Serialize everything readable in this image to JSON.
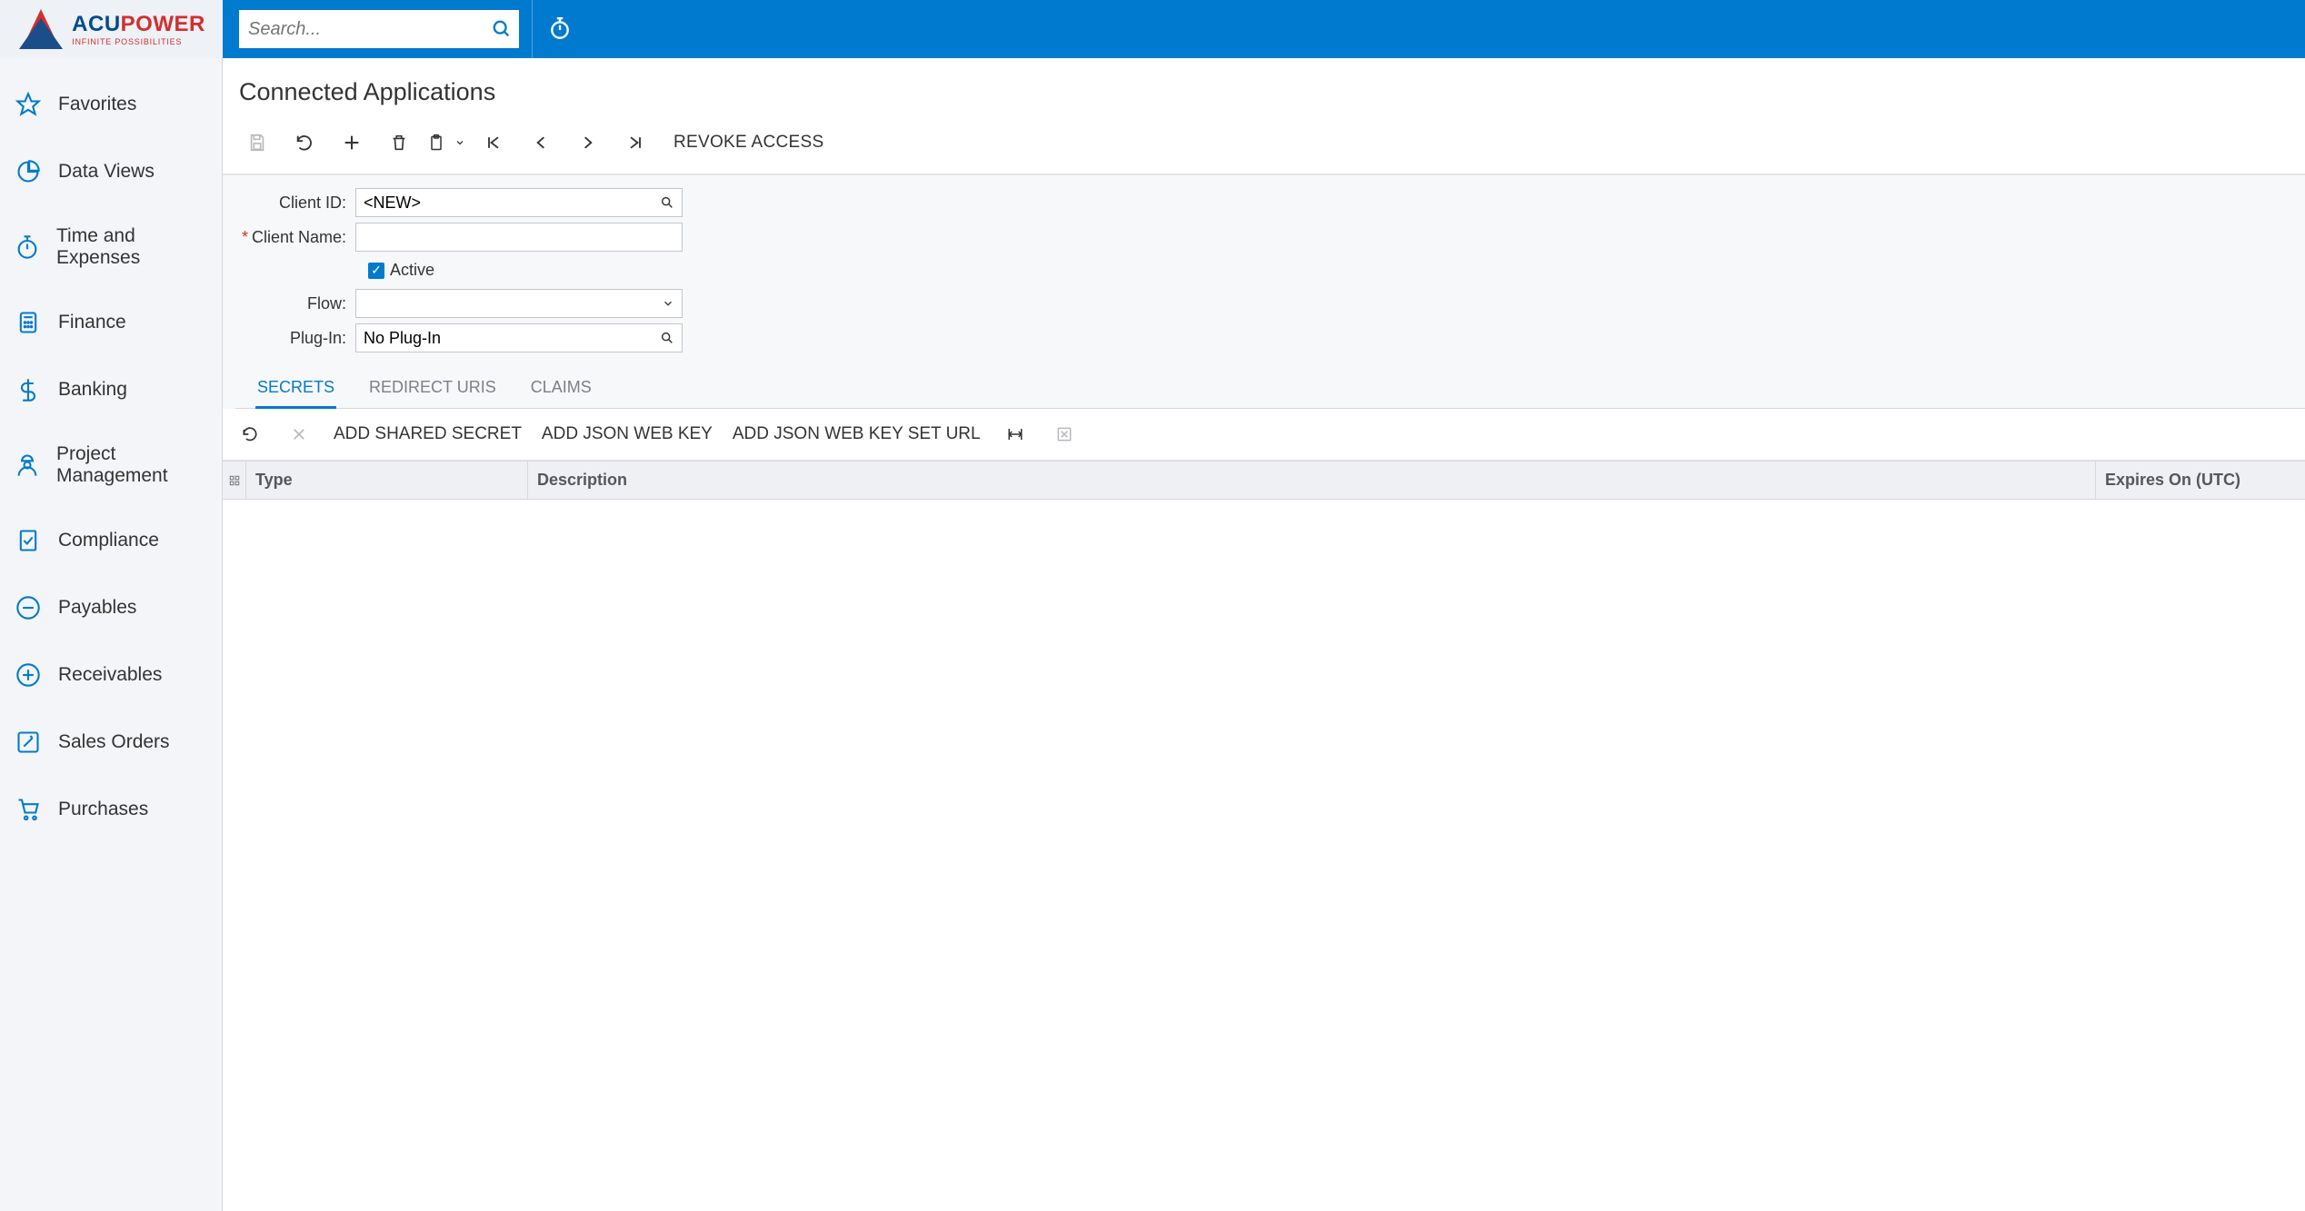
{
  "brand": {
    "part1": "ACU",
    "part2": "POWER",
    "tagline": "INFINITE POSSIBILITIES"
  },
  "search": {
    "placeholder": "Search..."
  },
  "sidebar": {
    "items": [
      {
        "label": "Favorites"
      },
      {
        "label": "Data Views"
      },
      {
        "label": "Time and Expenses"
      },
      {
        "label": "Finance"
      },
      {
        "label": "Banking"
      },
      {
        "label": "Project Management"
      },
      {
        "label": "Compliance"
      },
      {
        "label": "Payables"
      },
      {
        "label": "Receivables"
      },
      {
        "label": "Sales Orders"
      },
      {
        "label": "Purchases"
      }
    ]
  },
  "page": {
    "title": "Connected Applications"
  },
  "toolbar": {
    "revoke": "REVOKE ACCESS"
  },
  "form": {
    "client_id_label": "Client ID:",
    "client_id_value": "<NEW>",
    "client_name_label": "Client Name:",
    "client_name_value": "",
    "active_label": "Active",
    "flow_label": "Flow:",
    "flow_value": "",
    "plugin_label": "Plug-In:",
    "plugin_value": "No Plug-In"
  },
  "tabs": [
    {
      "label": "SECRETS",
      "active": true
    },
    {
      "label": "REDIRECT URIS",
      "active": false
    },
    {
      "label": "CLAIMS",
      "active": false
    }
  ],
  "subtoolbar": {
    "add_shared": "ADD SHARED SECRET",
    "add_jwk": "ADD JSON WEB KEY",
    "add_jwkset": "ADD JSON WEB KEY SET URL"
  },
  "grid": {
    "cols": {
      "type": "Type",
      "desc": "Description",
      "exp": "Expires On (UTC)"
    }
  }
}
